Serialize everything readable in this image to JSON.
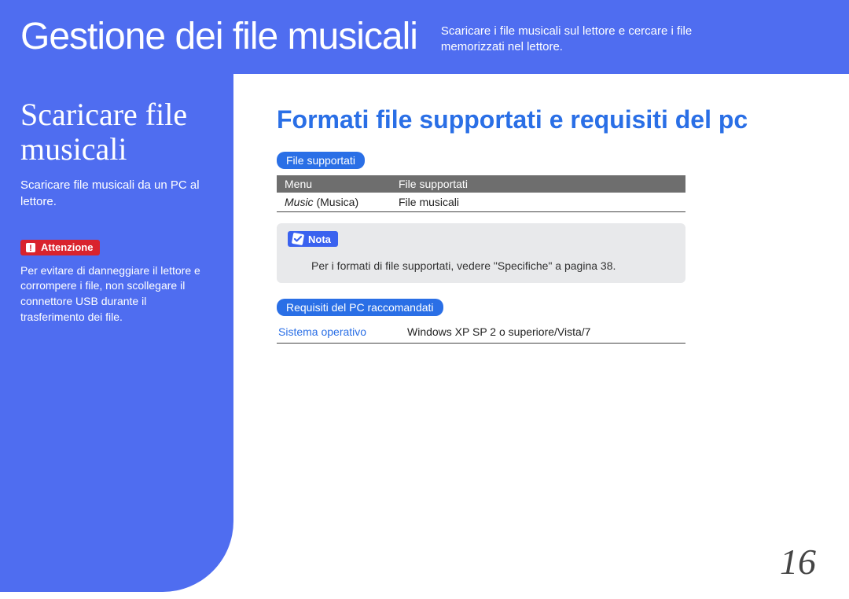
{
  "header": {
    "title": "Gestione dei file musicali",
    "description": "Scaricare i file musicali sul lettore e cercare i file memorizzati nel lettore."
  },
  "sidebar": {
    "title": "Scaricare file musicali",
    "subtitle": "Scaricare file musicali da un PC al lettore.",
    "warning_badge": "Attenzione",
    "warning_text": "Per evitare di danneggiare il lettore e corrompere i file, non scollegare il connettore USB durante il trasferimento dei file."
  },
  "main": {
    "title": "Formati file supportati e requisiti del pc",
    "supported_pill": "File supportati",
    "table": {
      "head_menu": "Menu",
      "head_supported": "File supportati",
      "row_menu_it": "Music",
      "row_menu_paren": " (Musica)",
      "row_supported": "File musicali"
    },
    "note_badge": "Nota",
    "note_text": "Per i formati di file supportati, vedere \"Specifiche\" a pagina 38.",
    "req_pill": "Requisiti del PC raccomandati",
    "req_label": "Sistema operativo",
    "req_value": "Windows XP SP 2 o superiore/Vista/7"
  },
  "page_number": "16"
}
